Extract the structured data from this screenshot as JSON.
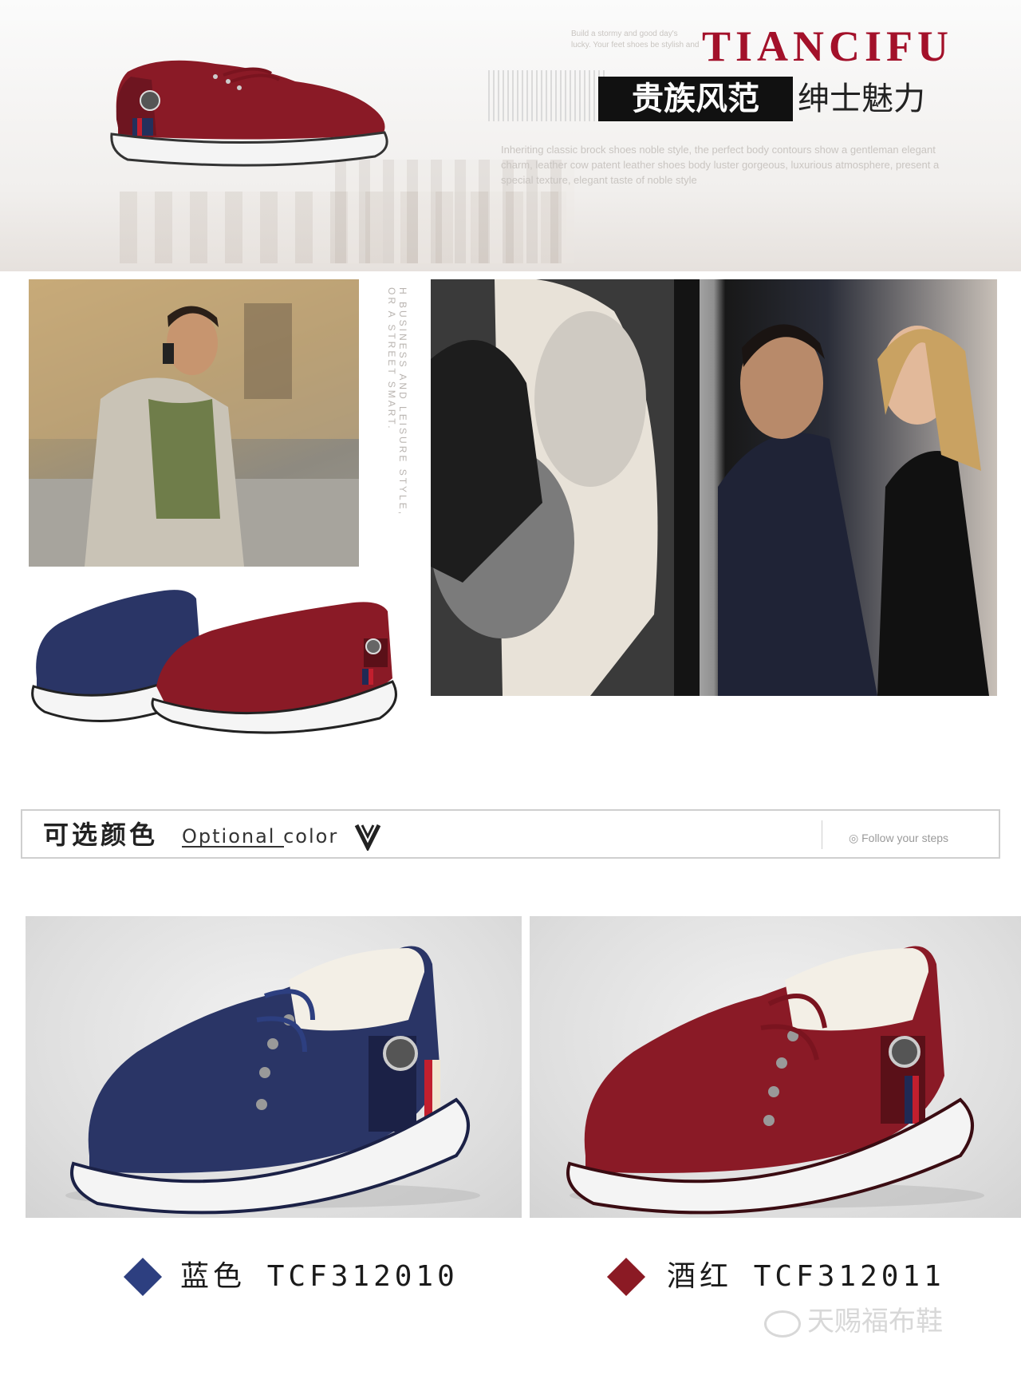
{
  "hero": {
    "brand": "TIANCIFU",
    "slogan_highlight": "贵族风范",
    "slogan_rest": "绅士魅力",
    "faint_lines_top": [
      "Build a stormy and good day's",
      "lucky. Your feet shoes be stylish and"
    ],
    "faint_lines": [
      "Inheriting classic brock shoes noble style, the perfect body contours show a gentleman elegant",
      "charm, leather cow patent leather shoes body luster gorgeous, luxurious atmosphere, present a",
      "special texture, elegant taste of noble style"
    ]
  },
  "side_caption": "H BUSINESS AND LEISURE STYLE, OR A STREET SMART.",
  "options": {
    "title_cn": "可选颜色",
    "title_en": "Optional  color",
    "right_text": "Follow your steps"
  },
  "products": [
    {
      "color_name": "蓝色",
      "code": "TCF312010",
      "swatch": "#2d3f80"
    },
    {
      "color_name": "酒红",
      "code": "TCF312011",
      "swatch": "#8b1a24"
    }
  ],
  "watermark": "天赐福布鞋",
  "colors": {
    "navy": "#2a3566",
    "wine": "#8a1a26",
    "brand_red": "#a3112a"
  }
}
